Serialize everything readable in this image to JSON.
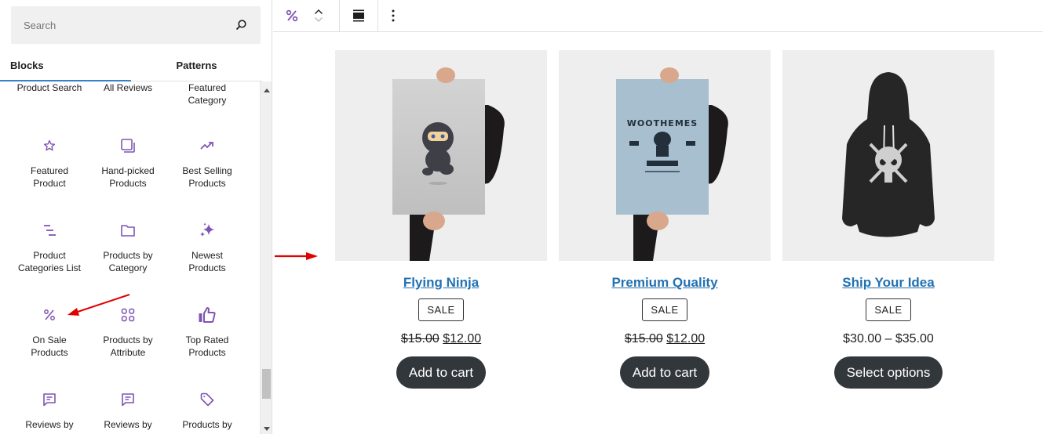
{
  "sidebar": {
    "search": {
      "placeholder": "Search",
      "value": ""
    },
    "tabs": [
      {
        "label": "Blocks",
        "active": true
      },
      {
        "label": "Patterns",
        "active": false
      }
    ],
    "blocks": [
      {
        "label": "Product Search",
        "icon": "search-icon"
      },
      {
        "label": "All Reviews",
        "icon": "comment-icon"
      },
      {
        "label": "Featured Category",
        "icon": "folder-star-icon"
      },
      {
        "label": "Featured Product",
        "icon": "star-icon"
      },
      {
        "label": "Hand-picked Products",
        "icon": "stacked-squares-icon"
      },
      {
        "label": "Best Selling Products",
        "icon": "trending-up-icon"
      },
      {
        "label": "Product Categories List",
        "icon": "list-icon"
      },
      {
        "label": "Products by Category",
        "icon": "folder-icon"
      },
      {
        "label": "Newest Products",
        "icon": "sparkles-icon"
      },
      {
        "label": "On Sale Products",
        "icon": "percent-icon"
      },
      {
        "label": "Products by Attribute",
        "icon": "grid-icon"
      },
      {
        "label": "Top Rated Products",
        "icon": "thumbs-up-icon"
      },
      {
        "label": "Reviews by",
        "icon": "comment-icon"
      },
      {
        "label": "Reviews by",
        "icon": "comment-icon"
      },
      {
        "label": "Products by",
        "icon": "tag-icon"
      }
    ]
  },
  "toolbar": {
    "block_type_icon": "percent-icon",
    "move_up": "Move up",
    "move_down": "Move down",
    "align_icon": "align-wide-icon",
    "more_options": "More options"
  },
  "products": [
    {
      "title": "Flying Ninja",
      "badge": "SALE",
      "price_old": "$15.00",
      "price_new": "$12.00",
      "price_range": null,
      "button": "Add to cart",
      "image": "poster-ninja"
    },
    {
      "title": "Premium Quality",
      "badge": "SALE",
      "price_old": "$15.00",
      "price_new": "$12.00",
      "price_range": null,
      "button": "Add to cart",
      "image": "poster-woothemes",
      "poster_text": "WOOTHEMES"
    },
    {
      "title": "Ship Your Idea",
      "badge": "SALE",
      "price_old": null,
      "price_new": null,
      "price_range": "$30.00 – $35.00",
      "button": "Select options",
      "image": "hoodie"
    }
  ],
  "colors": {
    "accent_purple": "#7f54b3",
    "link_blue": "#2271b1",
    "tab_underline": "#3582c4",
    "button_dark": "#32373c",
    "annotation_red": "#e00000"
  }
}
